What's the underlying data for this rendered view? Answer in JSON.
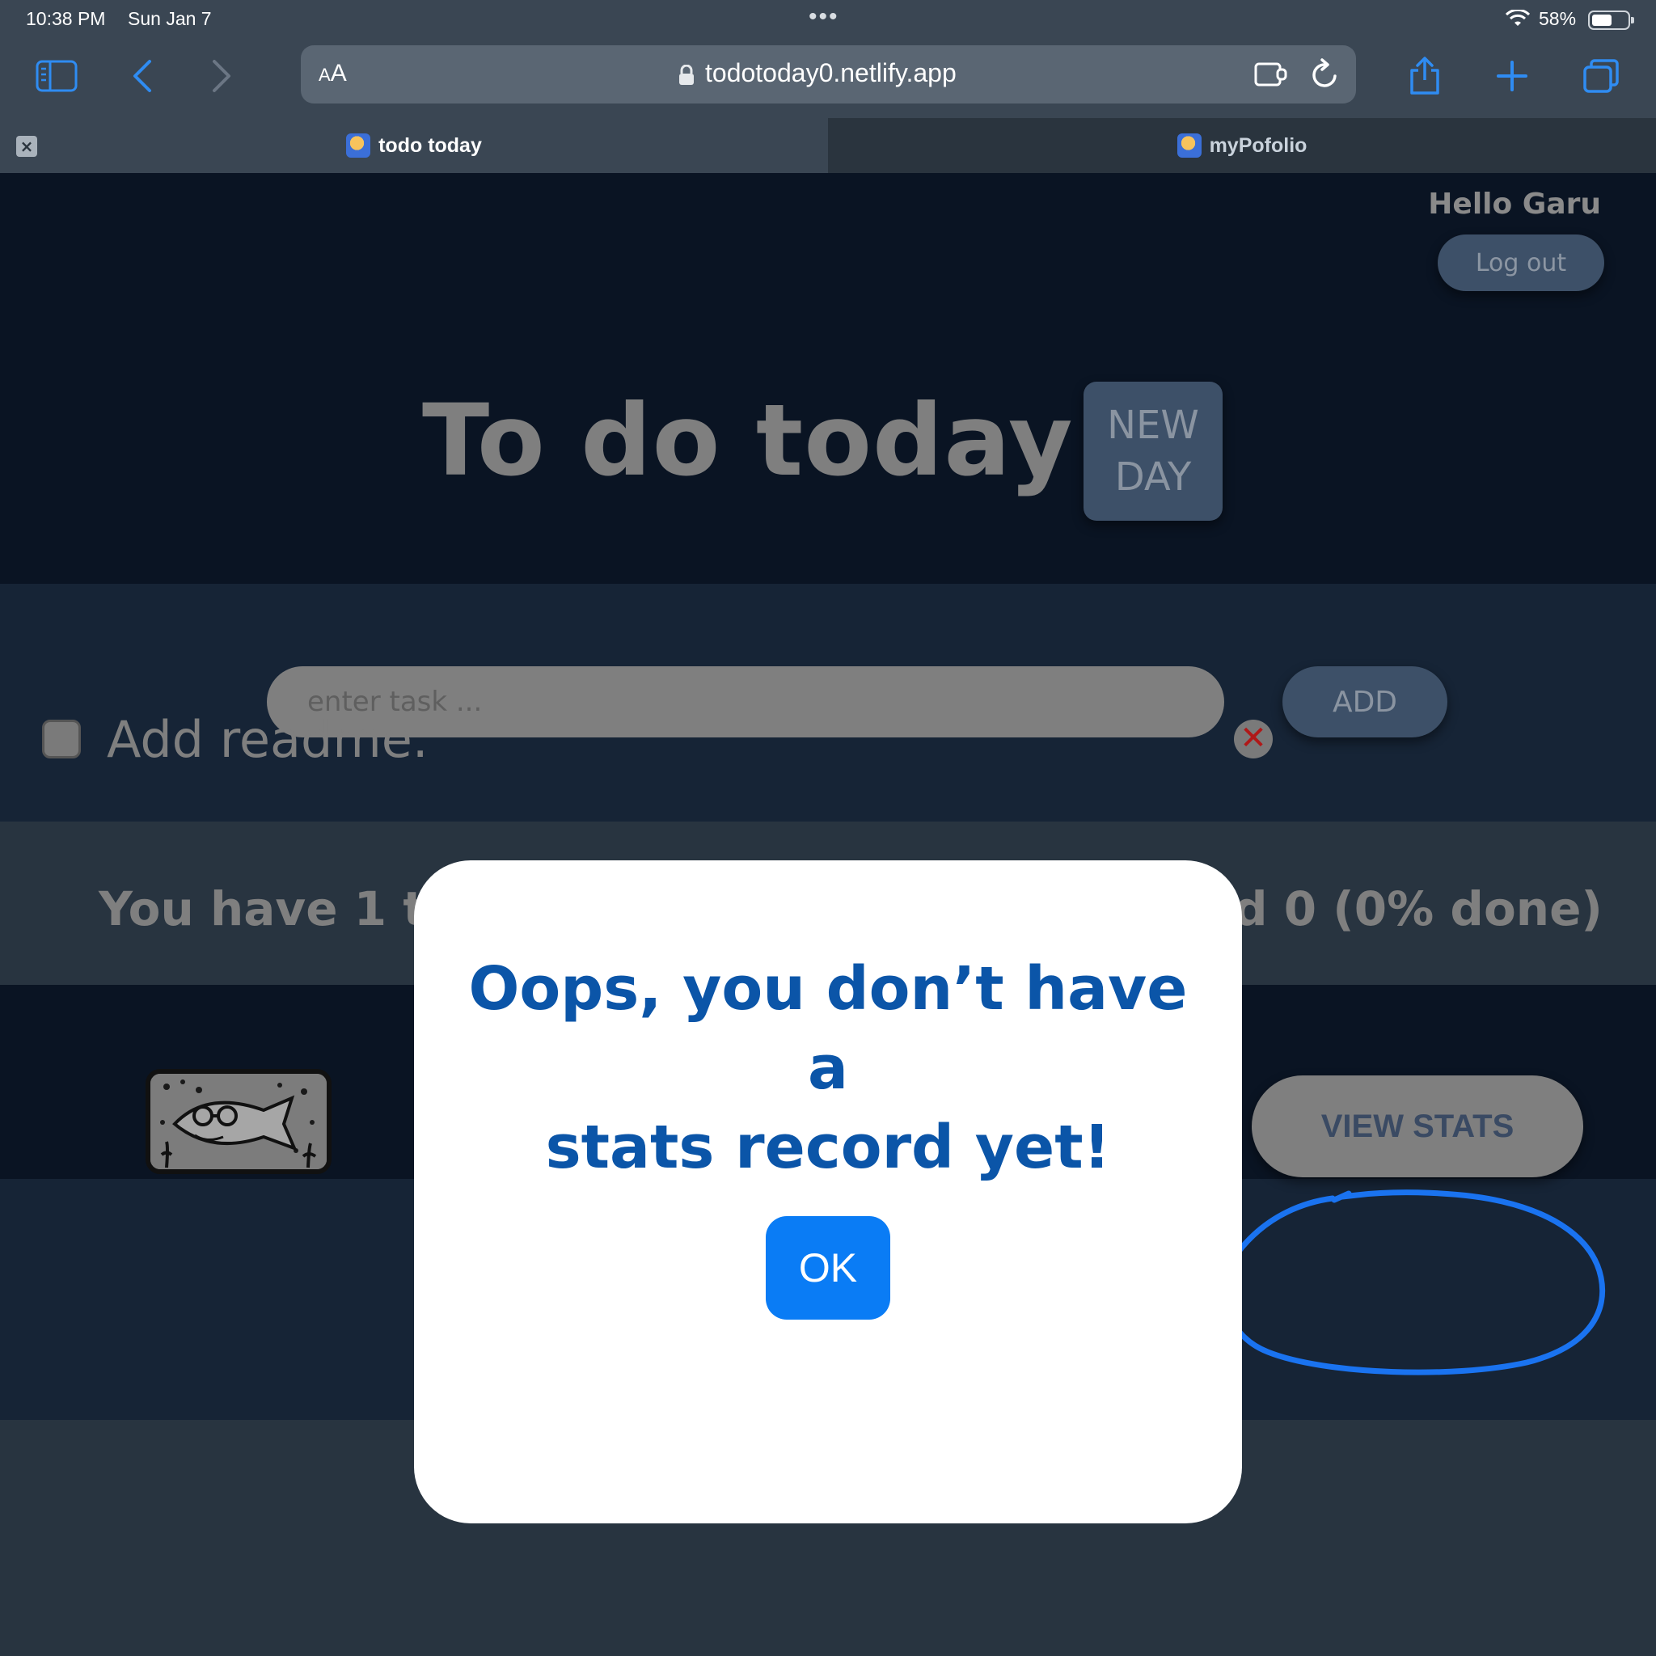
{
  "status_bar": {
    "time": "10:38 PM",
    "date": "Sun Jan 7",
    "battery_percent": "58%",
    "battery_level": 0.58
  },
  "browser": {
    "reader_label_small": "A",
    "reader_label_large": "A",
    "url": "todotoday0.netlify.app",
    "tabs": [
      {
        "label": "todo today",
        "active": true
      },
      {
        "label": "myPofolio",
        "active": false
      }
    ],
    "icons": [
      "sidebar-icon",
      "back-icon",
      "forward-icon",
      "lock-icon",
      "extension-icon",
      "reload-icon",
      "share-icon",
      "new-tab-icon",
      "tabs-overview-icon"
    ]
  },
  "app": {
    "greeting": "Hello Garu",
    "logout_label": "Log out",
    "title": "To do today",
    "new_day_line1": "NEW",
    "new_day_line2": "DAY",
    "task_input_placeholder": "enter task ...",
    "add_label": "ADD",
    "task": {
      "text": "Add readme.",
      "checked": false
    },
    "summary_left": "You have 1 ta",
    "summary_right": "d 0 (0% done)",
    "view_stats_label": "VIEW STATS"
  },
  "modal": {
    "message_line1": "Oops, you don’t have a",
    "message_line2": "stats record yet!",
    "ok_label": "OK"
  },
  "colors": {
    "modal_text": "#0b55a8",
    "ok_button": "#0a7cf5",
    "annotation_circle": "#1a73f0",
    "header_bg": "#0a1423",
    "band_bg": "#162436"
  }
}
